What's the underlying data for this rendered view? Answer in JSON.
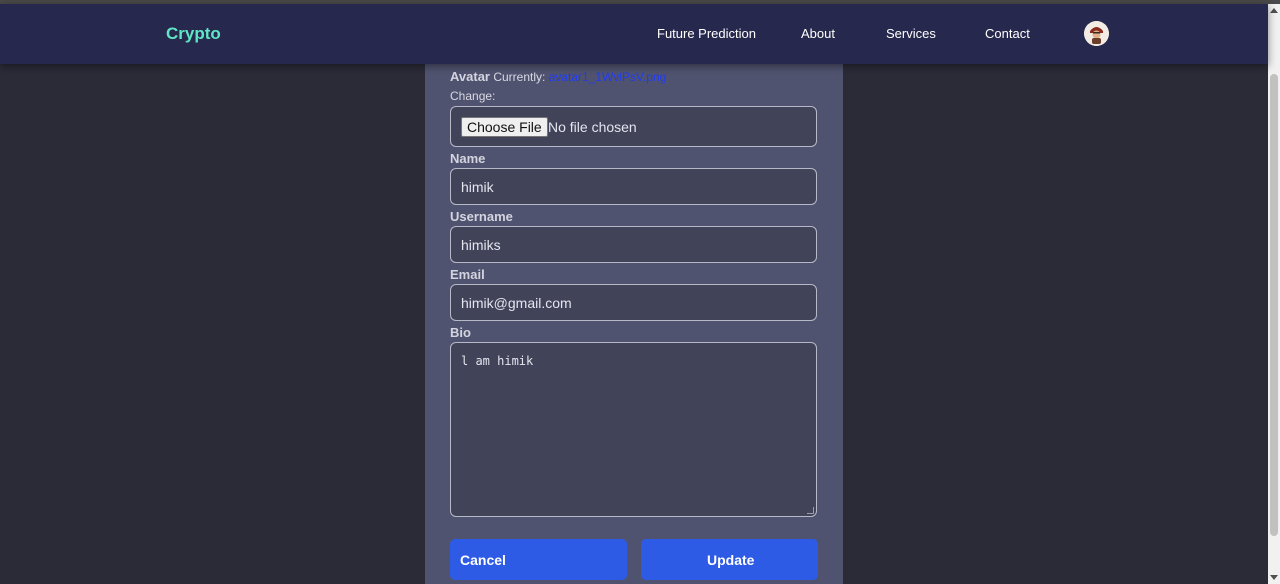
{
  "brand": "Crypto",
  "nav": {
    "items": [
      "Future Prediction",
      "About",
      "Services",
      "Contact"
    ],
    "avatar_icon": "user-avatar-icon"
  },
  "form": {
    "avatar_label": "Avatar",
    "currently_label": "Currently:",
    "current_file": "avatar1_1WvlPsV.png",
    "change_label": "Change:",
    "choose_file_label": "Choose File",
    "no_file_text": "No file chosen",
    "name_label": "Name",
    "name_value": "himik",
    "username_label": "Username",
    "username_value": "himiks",
    "email_label": "Email",
    "email_value": "himik@gmail.com",
    "bio_label": "Bio",
    "bio_value": "l am himik",
    "cancel_label": "Cancel",
    "update_label": "Update"
  },
  "colors": {
    "navbar": "#27284d",
    "brand": "#5ee6c6",
    "page_bg": "#2b2b38",
    "panel": "#50536f",
    "field_bg": "#414359",
    "button": "#2e5be6",
    "link": "#1f3cf0"
  }
}
